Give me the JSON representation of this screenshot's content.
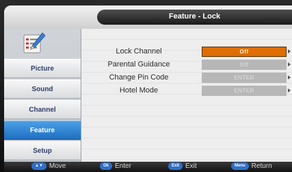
{
  "title": "Feature - Lock",
  "sidebar": {
    "icon": "settings-checklist-icon",
    "items": [
      {
        "label": "Picture"
      },
      {
        "label": "Sound"
      },
      {
        "label": "Channel"
      },
      {
        "label": "Feature"
      },
      {
        "label": "Setup"
      }
    ],
    "active_index": 3
  },
  "menu": {
    "rows": [
      {
        "label": "Lock Channel",
        "value": "Off"
      },
      {
        "label": "Parental Guidance",
        "value": "Off"
      },
      {
        "label": "Change Pin Code",
        "value": "ENTER"
      },
      {
        "label": "Hotel Mode",
        "value": "ENTER"
      }
    ],
    "selected_index": 0
  },
  "footer": {
    "move": {
      "key": "▲▼",
      "label": "Move"
    },
    "enter": {
      "key": "Ok",
      "label": "Enter"
    },
    "exit": {
      "key": "Exit",
      "label": "Exit"
    },
    "return": {
      "key": "Menu",
      "label": "Return"
    }
  },
  "colors": {
    "accent_blue": "#2f6fc9",
    "selected_orange": "#e06d00",
    "disabled_gray": "#b7b7b7"
  }
}
